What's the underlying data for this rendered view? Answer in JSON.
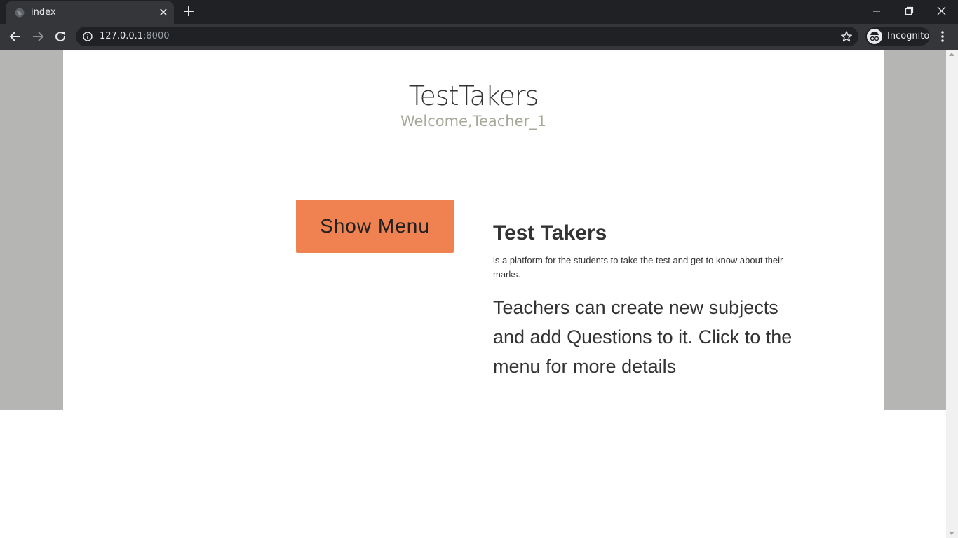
{
  "browser": {
    "tab_title": "index",
    "tab_close": "✕",
    "new_tab": "+",
    "url_host": "127.0.0.1",
    "url_port": ":8000",
    "profile_label": "Incognito",
    "icons": [
      "globe-icon",
      "close-icon",
      "plus-icon",
      "minimize-icon",
      "restore-icon",
      "close-window-icon",
      "back-arrow-icon",
      "forward-arrow-icon",
      "reload-icon",
      "info-icon",
      "star-icon",
      "incognito-icon",
      "more-menu-icon"
    ]
  },
  "page": {
    "title": "TestTakers",
    "welcome": "Welcome,Teacher_1",
    "menu_button_label": "Show Menu",
    "info_heading": "Test Takers",
    "info_small": "is a platform for the students to take the test and get to know about their marks.",
    "info_large": "Teachers can create new subjects and add Questions to it. Click to the menu for more details"
  },
  "colors": {
    "chrome_dark": "#202124",
    "chrome_toolbar": "#35363a",
    "page_background": "#b5b5b3",
    "button_orange": "#f08150",
    "welcome_text": "#a8a89a"
  }
}
